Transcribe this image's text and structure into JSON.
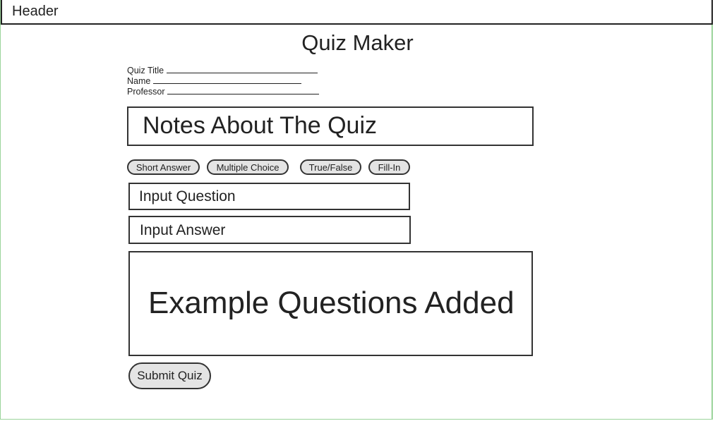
{
  "header": {
    "label": "Header"
  },
  "page": {
    "title": "Quiz Maker"
  },
  "fields": [
    {
      "label": "Quiz Title",
      "underline": "___________________________"
    },
    {
      "label": "Name",
      "underline": "___________________________"
    },
    {
      "label": "Professor",
      "underline": "___________________________"
    }
  ],
  "notes": {
    "text": "Notes About The Quiz"
  },
  "question_types": [
    "Short Answer",
    "Multiple Choice",
    "True/False",
    "Fill-In"
  ],
  "inputs": {
    "question_text": "Input Question",
    "answer_text": "Input Answer"
  },
  "examples": {
    "text": "Example Questions Added"
  },
  "submit": {
    "label": "Submit Quiz"
  },
  "colors": {
    "outer_border": "#9bd49b",
    "button_fill": "#e4e4e4",
    "stroke": "#333333"
  }
}
